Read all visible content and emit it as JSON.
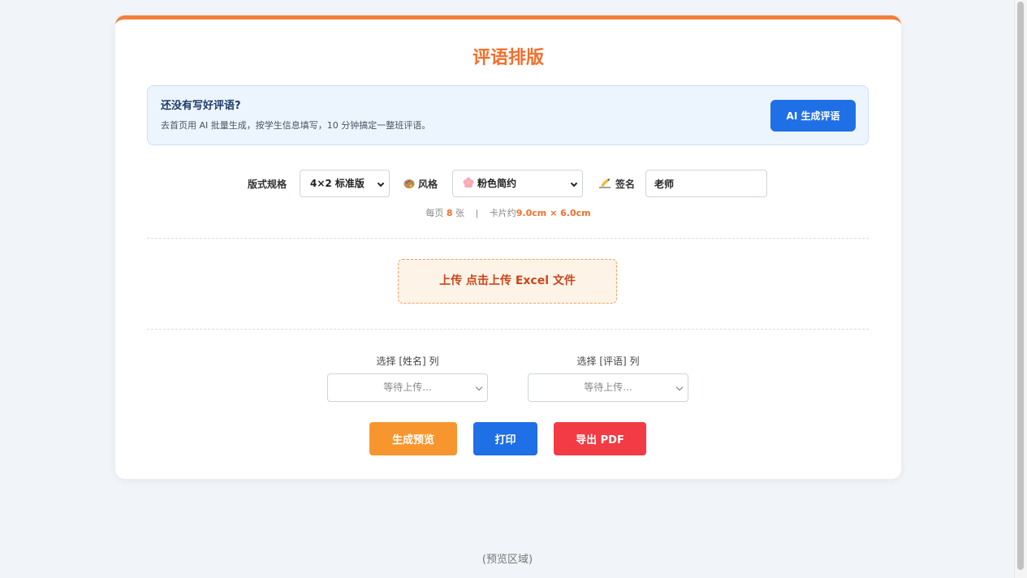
{
  "page": {
    "title": "评语排版",
    "accent_color": "#f26f2d"
  },
  "banner": {
    "title": "还没有写好评语?",
    "subtitle": "去首页用 AI 批量生成，按学生信息填写，10 分钟搞定一整班评语。",
    "button_label": "AI 生成评语"
  },
  "controls": {
    "layout_label": "版式规格",
    "layout_value": "4×2 标准版",
    "style_label": "风格",
    "style_icon": "palette-icon",
    "style_value": "粉色简约",
    "style_value_icon": "flower-icon",
    "signature_label": "签名",
    "signature_icon": "writing-hand-icon",
    "signature_value": "老师"
  },
  "spec": {
    "per_page_prefix": "每页",
    "per_page_count": "8",
    "per_page_unit": "张",
    "separator": "|",
    "card_size_prefix": "卡片约",
    "card_size_value": "9.0cm × 6.0cm"
  },
  "upload": {
    "label": "上传  点击上传 Excel 文件"
  },
  "columns": {
    "name_label": "选择 [姓名] 列",
    "name_placeholder": "等待上传...",
    "comment_label": "选择 [评语] 列",
    "comment_placeholder": "等待上传..."
  },
  "actions": {
    "preview_label": "生成预览",
    "preview_color": "#f7962e",
    "print_label": "打印",
    "print_color": "#1f6fe6",
    "export_label": "导出 PDF",
    "export_color": "#f23b45"
  },
  "preview_area": {
    "placeholder": "(预览区域)"
  }
}
